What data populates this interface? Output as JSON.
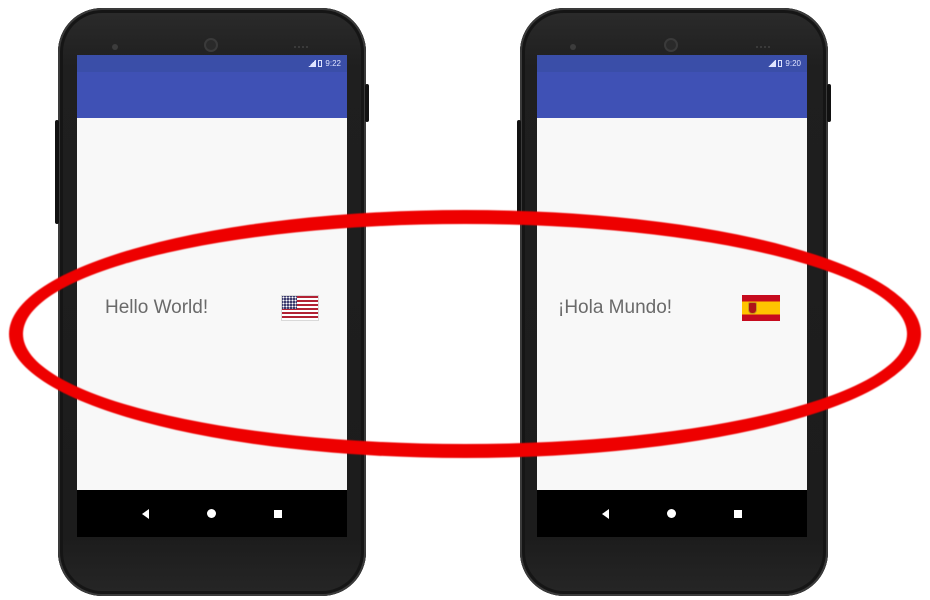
{
  "phones": [
    {
      "status_time": "9:22",
      "greeting": "Hello World!",
      "flag_icon": "us-flag-icon"
    },
    {
      "status_time": "9:20",
      "greeting": "¡Hola Mundo!",
      "flag_icon": "spain-flag-icon"
    }
  ],
  "annotation": {
    "shape": "ellipse",
    "color": "#ee0000"
  },
  "colors": {
    "app_bar": "#3f51b5",
    "status_bar": "#3a4ea8",
    "nav_bar": "#000000",
    "screen_bg": "#f8f8f8",
    "text": "#6a6a6a"
  },
  "nav_icons": [
    "back-icon",
    "home-icon",
    "recents-icon"
  ]
}
